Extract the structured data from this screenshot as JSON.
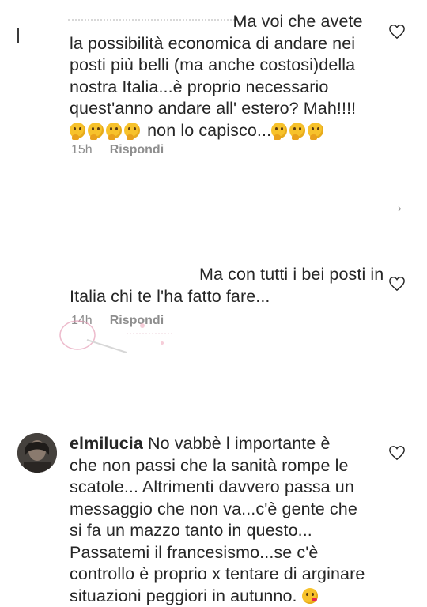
{
  "comments": [
    {
      "username": "",
      "lines": [
        "                                  Ma voi che avete",
        "la possibilità economica di andare nei",
        "posti più belli (ma anche costosi)della",
        "nostra Italia...è proprio necessario",
        "quest'anno andare all' estero? Mah!!!!"
      ],
      "last_line_text": " non lo capisco...",
      "time": "15h",
      "reply_label": "Rispondi"
    },
    {
      "username": "",
      "lines": [
        "                           Ma con tutti i bei posti in",
        "Italia chi te l'ha fatto fare..."
      ],
      "time": "14h",
      "reply_label": "Rispondi"
    },
    {
      "username": "elmilucia",
      "lines": [
        " No vabbè l importante è",
        "che non passi che la sanità rompe le",
        "scatole... Altrimenti davvero passa un",
        "messaggio che non va...c'è gente che",
        "si fa un mazzo tanto in questo...",
        "Passatemi il francesismo...se c'è",
        "controllo è proprio x tentare di arginare",
        "situazioni peggiori in autunno. "
      ]
    }
  ],
  "icons": {
    "heart": "heart-outline-icon",
    "thinking": "thinking-face-emoji",
    "kiss": "face-blowing-kiss-emoji",
    "chevron": "chevron-right-icon"
  },
  "colors": {
    "text": "#262626",
    "meta": "#8e8e8e",
    "background": "#ffffff"
  }
}
